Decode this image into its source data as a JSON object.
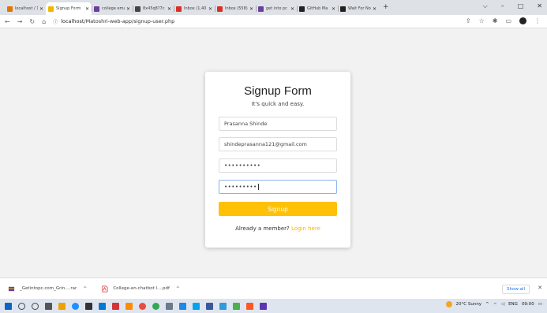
{
  "browser": {
    "tabs": [
      {
        "label": "localhost / 1",
        "color": "#e37400",
        "active": false
      },
      {
        "label": "Signup Form",
        "color": "#f4b400",
        "active": true
      },
      {
        "label": "college ema",
        "color": "#6b3fa0",
        "active": false
      },
      {
        "label": "8x45q8?7c",
        "color": "#444444",
        "active": false
      },
      {
        "label": "Inbox (1,40",
        "color": "#d93025",
        "active": false
      },
      {
        "label": "Inbox (558)",
        "color": "#d93025",
        "active": false
      },
      {
        "label": "get into pc",
        "color": "#6b3fa0",
        "active": false
      },
      {
        "label": "GitHub Ma",
        "color": "#222222",
        "active": false
      },
      {
        "label": "Wait For No",
        "color": "#222222",
        "active": false
      }
    ],
    "new_tab": "+",
    "url_host": "localhost",
    "url_path": "/Matoshri-web-app/signup-user.php"
  },
  "form": {
    "title": "Signup Form",
    "subtitle": "It's quick and easy.",
    "name_value": "Prasanna Shinde",
    "email_value": "shindeprasanna121@gmail.com",
    "password_value": "••••••••••",
    "confirm_password_value": "•••••••••",
    "signup_label": "Signup",
    "member_text": "Already a member?",
    "login_link": "Login here",
    "accent_color": "#ffc107"
  },
  "downloads": {
    "items": [
      {
        "label": "_Getintopc.com_Grin....rar",
        "icon": "archive-icon"
      },
      {
        "label": "College-en-chatbot l....pdf",
        "icon": "pdf-icon"
      }
    ],
    "show_all": "Show all"
  },
  "taskbar": {
    "weather": "20°C Sunny",
    "language": "ENG",
    "time": "09:00"
  }
}
